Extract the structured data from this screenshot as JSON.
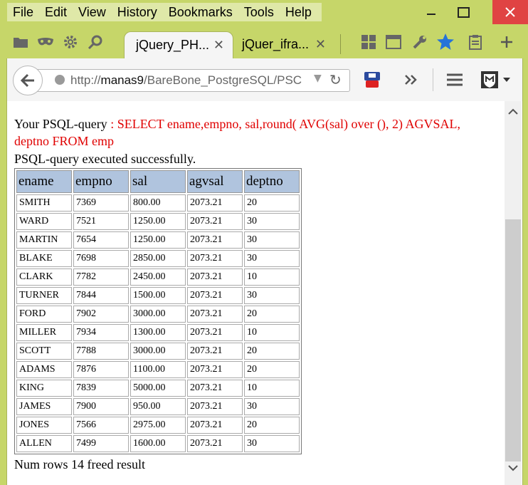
{
  "menubar": {
    "items": [
      "File",
      "Edit",
      "View",
      "History",
      "Bookmarks",
      "Tools",
      "Help"
    ]
  },
  "tabs": [
    {
      "title": "jQuery_PH...",
      "active": true
    },
    {
      "title": "jQuer_ifra...",
      "active": false
    }
  ],
  "navbar": {
    "url_prefix": "http://",
    "url_host": "manas9",
    "url_path": "/BareBone_PostgreSQL/PSC"
  },
  "page": {
    "query_label": "Your PSQL-query",
    "query_text": ": SELECT ename,empno, sal,round( AVG(sal) over (), 2) AGVSAL, deptno FROM emp",
    "status": "PSQL-query executed successfully.",
    "footer": "Num rows 14 freed result"
  },
  "table": {
    "headers": [
      "ename",
      "empno",
      "sal",
      "agvsal",
      "deptno"
    ],
    "rows": [
      [
        "SMITH",
        "7369",
        "800.00",
        "2073.21",
        "20"
      ],
      [
        "WARD",
        "7521",
        "1250.00",
        "2073.21",
        "30"
      ],
      [
        "MARTIN",
        "7654",
        "1250.00",
        "2073.21",
        "30"
      ],
      [
        "BLAKE",
        "7698",
        "2850.00",
        "2073.21",
        "30"
      ],
      [
        "CLARK",
        "7782",
        "2450.00",
        "2073.21",
        "10"
      ],
      [
        "TURNER",
        "7844",
        "1500.00",
        "2073.21",
        "30"
      ],
      [
        "FORD",
        "7902",
        "3000.00",
        "2073.21",
        "20"
      ],
      [
        "MILLER",
        "7934",
        "1300.00",
        "2073.21",
        "10"
      ],
      [
        "SCOTT",
        "7788",
        "3000.00",
        "2073.21",
        "20"
      ],
      [
        "ADAMS",
        "7876",
        "1100.00",
        "2073.21",
        "20"
      ],
      [
        "KING",
        "7839",
        "5000.00",
        "2073.21",
        "10"
      ],
      [
        "JAMES",
        "7900",
        "950.00",
        "2073.21",
        "30"
      ],
      [
        "JONES",
        "7566",
        "2975.00",
        "2073.21",
        "20"
      ],
      [
        "ALLEN",
        "7499",
        "1600.00",
        "2073.21",
        "30"
      ]
    ]
  },
  "colors": {
    "chrome": "#c6d669",
    "header_bg": "#b0c4de",
    "query_red": "#e00000",
    "close_red": "#e04343"
  }
}
